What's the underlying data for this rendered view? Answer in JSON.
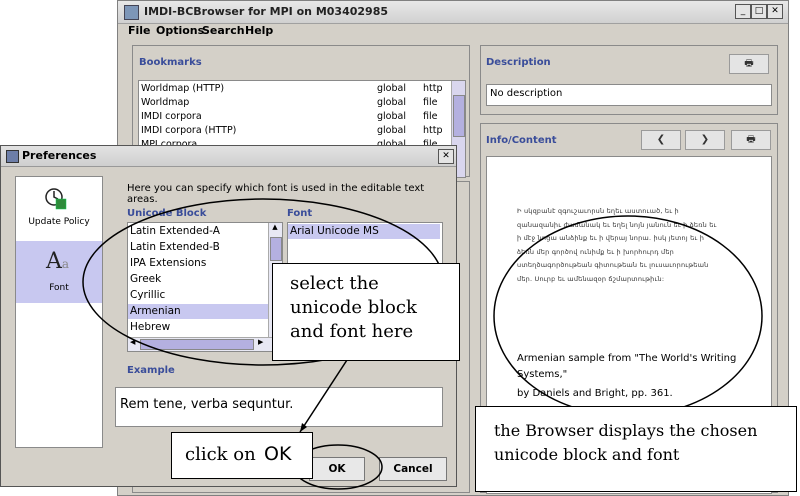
{
  "browser": {
    "title": "IMDI-BCBrowser for MPI on M03402985",
    "menu": [
      "File",
      "Options",
      "Search",
      "Help"
    ],
    "bookmarks": {
      "title": "Bookmarks",
      "rows": [
        {
          "name": "Worldmap (HTTP)",
          "scope": "global",
          "type": "http"
        },
        {
          "name": "Worldmap",
          "scope": "global",
          "type": "file"
        },
        {
          "name": "IMDI corpora",
          "scope": "global",
          "type": "file"
        },
        {
          "name": "IMDI corpora (HTTP)",
          "scope": "global",
          "type": "http"
        },
        {
          "name": "MPI corpora",
          "scope": "global",
          "type": "file"
        }
      ]
    },
    "description": {
      "title": "Description",
      "text": "No description"
    },
    "info": {
      "title": "Info/Content",
      "armenian_text": "Ի սկզբանէ զգուշաւորսն եղեւ աստուած, եւ ի զանազանիւ ժամանակ եւ եղել նոյն յանուն եւ ի ձեռն եւ ի մէջ նոցա անձինք եւ ի վերայ նորա. իսկ յետոյ եւ ի ձեռն մեր գործով ունիմք եւ ի խորհուրդ մեր ստեղծագործութեան գիտութեան եւ լուսաւորութեան մեր. Սուրբ եւ ամենազօր ճշմարտութիւն:",
      "caption_line1": "Armenian sample from \"The World's Writing",
      "caption_line2": "Systems,\"",
      "caption_line3": "by Daniels and Bright, pp. 361."
    }
  },
  "prefs": {
    "title": "Preferences",
    "side": [
      {
        "label": "Update Policy"
      },
      {
        "label": "Font"
      }
    ],
    "intro": "Here you can specify which font is used in the editable text areas.",
    "unicode_block_label": "Unicode Block",
    "font_label": "Font",
    "blocks": [
      "Latin Extended-A",
      "Latin Extended-B",
      "IPA Extensions",
      "Greek",
      "Cyrillic",
      "Armenian",
      "Hebrew"
    ],
    "selected_block_index": 5,
    "fonts": [
      "Arial Unicode MS"
    ],
    "example_label": "Example",
    "example_text": "Rem tene, verba sequntur.",
    "ok_label": "OK",
    "cancel_label": "Cancel"
  },
  "callouts": {
    "select_line1": "select the",
    "select_line2": "unicode block",
    "select_line3": "and font here",
    "click_text": "click on",
    "click_ok": "OK",
    "browser_line1": "the Browser displays the chosen",
    "browser_line2": "unicode block and font"
  }
}
